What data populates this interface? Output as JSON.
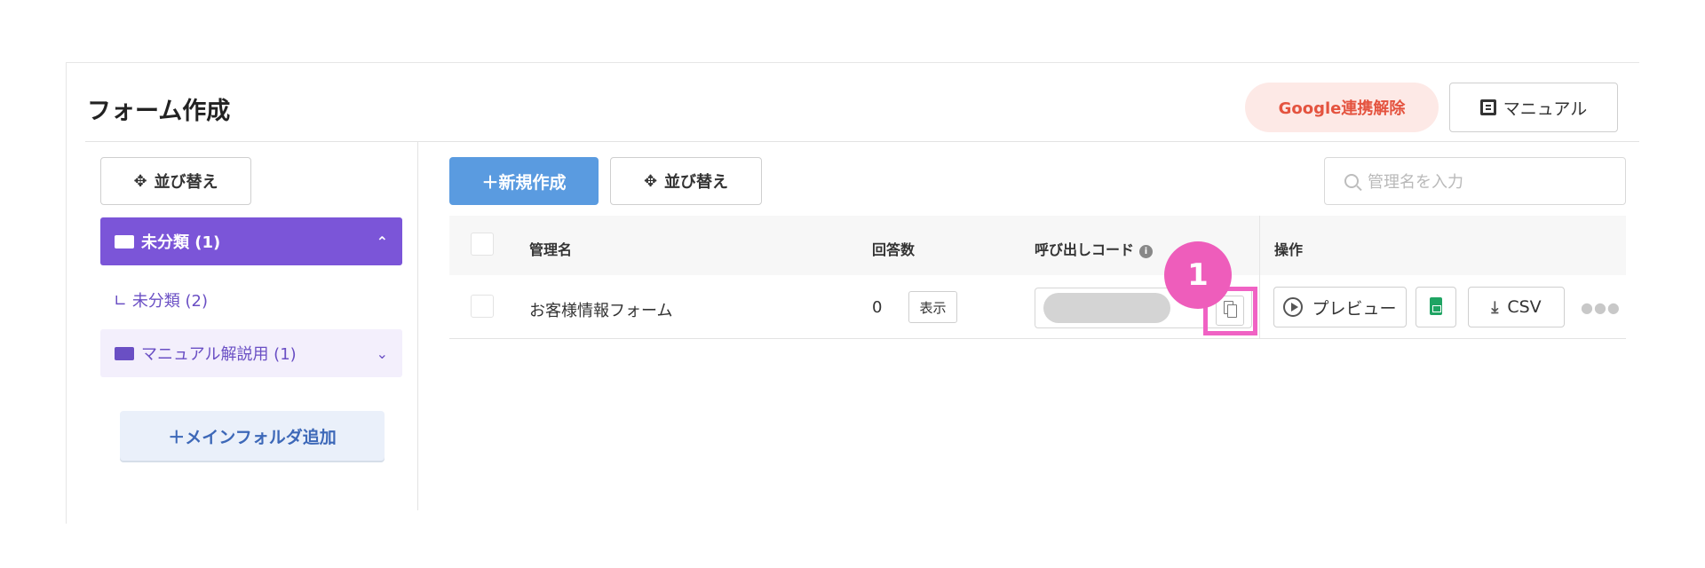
{
  "page": {
    "title": "フォーム作成"
  },
  "header": {
    "google_unlink_label": "Google連携解除",
    "manual_label": "マニュアル"
  },
  "sidebar": {
    "reorder_label": "並び替え",
    "folders": [
      {
        "label": "未分類 (1)",
        "state": "expanded",
        "active": true
      },
      {
        "label": "マニュアル解説用 (1)",
        "state": "collapsed",
        "active": false
      }
    ],
    "subfolder_label": "未分類 (2)",
    "add_folder_label": "＋メインフォルダ追加"
  },
  "toolbar": {
    "new_label": "＋新規作成",
    "reorder_label": "並び替え",
    "search_placeholder": "管理名を入力"
  },
  "table": {
    "columns": [
      "管理名",
      "回答数",
      "呼び出しコード",
      "操作"
    ],
    "rows": [
      {
        "name": "お客様情報フォーム",
        "responses": "0",
        "show_label": "表示",
        "preview_label": "プレビュー",
        "csv_label": "CSV"
      }
    ]
  },
  "annotation": {
    "marker": "1"
  },
  "colors": {
    "primary": "#5a9be0",
    "folder_active": "#7b55d8",
    "highlight": "#ee5dbb",
    "google_unlink_text": "#e4533f"
  }
}
